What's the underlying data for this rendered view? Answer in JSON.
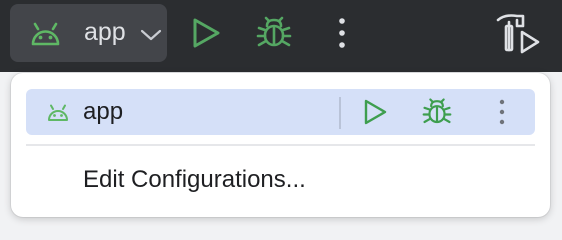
{
  "toolbar": {
    "run_config_label": "app",
    "colors": {
      "background": "#2b2d30",
      "widget": "#43454a",
      "android_green": "#5fb865",
      "run_green": "#55a763",
      "text": "#dfe1e5"
    },
    "icons": [
      "android-icon",
      "chevron-down-icon",
      "run-icon",
      "debug-icon",
      "more-vertical-icon",
      "build-icon"
    ]
  },
  "popup": {
    "config_label": "app",
    "edit_label": "Edit Configurations...",
    "colors": {
      "selected_row": "#d5e0f8",
      "android_green": "#5fb865",
      "run_green": "#3e9e4f"
    }
  }
}
